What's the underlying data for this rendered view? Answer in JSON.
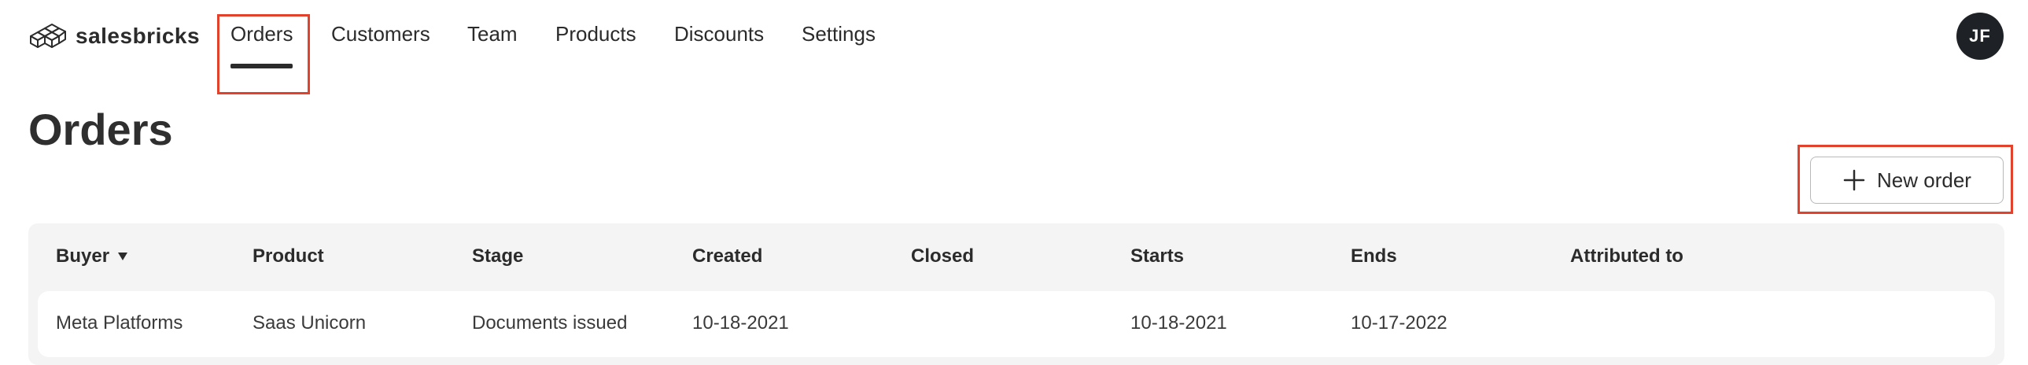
{
  "brand": {
    "name": "salesbricks",
    "logo_icon": "bricks-logo-icon"
  },
  "nav": {
    "items": [
      {
        "label": "Orders",
        "active": true
      },
      {
        "label": "Customers"
      },
      {
        "label": "Team"
      },
      {
        "label": "Products"
      },
      {
        "label": "Discounts"
      },
      {
        "label": "Settings"
      }
    ]
  },
  "user": {
    "initials": "JF"
  },
  "page": {
    "title": "Orders"
  },
  "actions": {
    "new_order_label": "New order",
    "new_order_icon": "plus-icon"
  },
  "table": {
    "columns": [
      "Buyer",
      "Product",
      "Stage",
      "Created",
      "Closed",
      "Starts",
      "Ends",
      "Attributed to"
    ],
    "sort_column": "Buyer",
    "sort_direction": "descending",
    "rows": [
      {
        "buyer": "Meta Platforms",
        "product": "Saas Unicorn",
        "stage": "Documents issued",
        "created": "10-18-2021",
        "closed": "",
        "starts": "10-18-2021",
        "ends": "10-17-2022",
        "attributed_to": ""
      }
    ]
  },
  "colors": {
    "highlight": "#e2412b",
    "avatar_bg": "#1e2226",
    "table_bg": "#f4f4f4"
  }
}
